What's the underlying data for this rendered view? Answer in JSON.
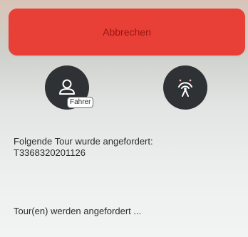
{
  "actions": {
    "cancel_label": "Abbrechen"
  },
  "driver": {
    "tag_label": "Fahrer",
    "icon": "person-icon"
  },
  "tower": {
    "icon": "radio-tower-icon"
  },
  "message": {
    "requested_intro": "Folgende Tour wurde angefordert:",
    "tour_id": "T3368320201126",
    "status": "Tour(en) werden angefordert ..."
  },
  "colors": {
    "cancel_bg": "#e84037",
    "cancel_text": "#9a1510",
    "round_button_bg": "#2f3234"
  }
}
